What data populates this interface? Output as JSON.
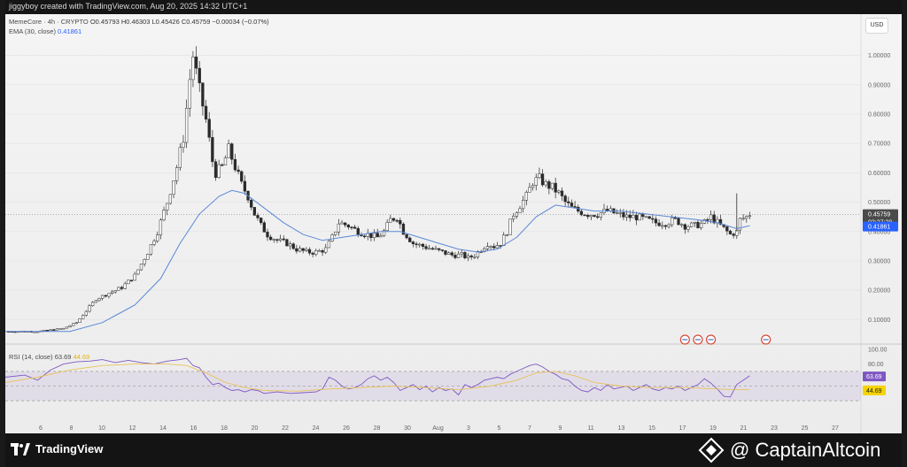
{
  "header": {
    "author_line": "jiggyboy created with TradingView.com, Aug 20, 2025 14:32 UTC+1",
    "symbol": "MemeCore · 4h · CRYPTO",
    "ohlc": "O0.45793  H0.46303  L0.45426  C0.45759  −0.00034 (−0.07%)",
    "ema_label": "EMA (30, close)",
    "ema_value": "0.41861",
    "currency_button": "USD"
  },
  "rsi": {
    "label": "RSI (14, close)",
    "value": "63.69",
    "ma_value": "44.69"
  },
  "footer": {
    "brand_left": "TradingView",
    "brand_right": "@ CaptainAltcoin"
  },
  "colors": {
    "up_candle": "#ffffff",
    "down_candle": "#2a2a2a",
    "ema": "#5b87d6",
    "rsi_line": "#7e57c2",
    "rsi_ma": "#e8c35a",
    "price_tag": "#4a4a4a",
    "ema_tag": "#2962ff",
    "rsi_ma_tag": "#f5d300"
  },
  "chart_data": [
    {
      "type": "candlestick",
      "title": "MemeCore · 4h · CRYPTO",
      "ylim": [
        0.05,
        1.05
      ],
      "yticks": [
        "1.00000",
        "0.90000",
        "0.80000",
        "0.70000",
        "0.60000",
        "0.50000",
        "0.40000",
        "0.30000",
        "0.20000",
        "0.10000"
      ],
      "xticks": [
        "6",
        "8",
        "10",
        "12",
        "14",
        "16",
        "18",
        "20",
        "22",
        "24",
        "26",
        "28",
        "30",
        "Aug",
        "3",
        "5",
        "7",
        "9",
        "11",
        "13",
        "15",
        "17",
        "19",
        "21",
        "23",
        "25",
        "27"
      ],
      "last_price": "0.45759",
      "countdown": "02:27:28",
      "ema_last": "0.41861",
      "price_path": [
        [
          0,
          0.06
        ],
        [
          10,
          0.06
        ],
        [
          18,
          0.07
        ],
        [
          22,
          0.09
        ],
        [
          25,
          0.13
        ],
        [
          28,
          0.17
        ],
        [
          32,
          0.19
        ],
        [
          36,
          0.21
        ],
        [
          40,
          0.25
        ],
        [
          44,
          0.33
        ],
        [
          47,
          0.4
        ],
        [
          50,
          0.5
        ],
        [
          53,
          0.62
        ],
        [
          55,
          0.72
        ],
        [
          57,
          0.92
        ],
        [
          58,
          1.0
        ],
        [
          60,
          0.88
        ],
        [
          62,
          0.78
        ],
        [
          64,
          0.64
        ],
        [
          65,
          0.6
        ],
        [
          67,
          0.62
        ],
        [
          69,
          0.68
        ],
        [
          71,
          0.62
        ],
        [
          73,
          0.56
        ],
        [
          75,
          0.52
        ],
        [
          77,
          0.46
        ],
        [
          79,
          0.42
        ],
        [
          81,
          0.39
        ],
        [
          84,
          0.37
        ],
        [
          87,
          0.36
        ],
        [
          90,
          0.34
        ],
        [
          93,
          0.33
        ],
        [
          96,
          0.33
        ],
        [
          99,
          0.34
        ],
        [
          101,
          0.38
        ],
        [
          103,
          0.43
        ],
        [
          106,
          0.42
        ],
        [
          109,
          0.4
        ],
        [
          112,
          0.39
        ],
        [
          115,
          0.38
        ],
        [
          117,
          0.4
        ],
        [
          119,
          0.44
        ],
        [
          121,
          0.45
        ],
        [
          123,
          0.4
        ],
        [
          126,
          0.36
        ],
        [
          129,
          0.35
        ],
        [
          132,
          0.34
        ],
        [
          135,
          0.33
        ],
        [
          138,
          0.32
        ],
        [
          141,
          0.32
        ],
        [
          143,
          0.31
        ],
        [
          145,
          0.32
        ],
        [
          147,
          0.34
        ],
        [
          149,
          0.36
        ],
        [
          151,
          0.35
        ],
        [
          153,
          0.36
        ],
        [
          155,
          0.4
        ],
        [
          157,
          0.46
        ],
        [
          159,
          0.49
        ],
        [
          161,
          0.52
        ],
        [
          163,
          0.57
        ],
        [
          165,
          0.58
        ],
        [
          167,
          0.56
        ],
        [
          169,
          0.55
        ],
        [
          171,
          0.53
        ],
        [
          173,
          0.5
        ],
        [
          175,
          0.48
        ],
        [
          177,
          0.47
        ],
        [
          180,
          0.46
        ],
        [
          183,
          0.46
        ],
        [
          186,
          0.47
        ],
        [
          189,
          0.46
        ],
        [
          192,
          0.45
        ],
        [
          195,
          0.45
        ],
        [
          198,
          0.44
        ],
        [
          201,
          0.43
        ],
        [
          204,
          0.43
        ],
        [
          207,
          0.44
        ],
        [
          210,
          0.42
        ],
        [
          213,
          0.42
        ],
        [
          216,
          0.43
        ],
        [
          218,
          0.45
        ],
        [
          220,
          0.43
        ],
        [
          222,
          0.41
        ],
        [
          224,
          0.39
        ],
        [
          226,
          0.4
        ],
        [
          227,
          0.44
        ],
        [
          229,
          0.45
        ],
        [
          230,
          0.46
        ]
      ],
      "series": [
        {
          "name": "EMA (30, close)",
          "points": [
            [
              0,
              0.06
            ],
            [
              20,
              0.06
            ],
            [
              30,
              0.09
            ],
            [
              40,
              0.15
            ],
            [
              48,
              0.24
            ],
            [
              54,
              0.36
            ],
            [
              60,
              0.46
            ],
            [
              66,
              0.52
            ],
            [
              70,
              0.54
            ],
            [
              74,
              0.53
            ],
            [
              80,
              0.48
            ],
            [
              86,
              0.43
            ],
            [
              92,
              0.39
            ],
            [
              98,
              0.37
            ],
            [
              104,
              0.38
            ],
            [
              110,
              0.39
            ],
            [
              116,
              0.4
            ],
            [
              122,
              0.4
            ],
            [
              128,
              0.38
            ],
            [
              134,
              0.36
            ],
            [
              140,
              0.34
            ],
            [
              146,
              0.33
            ],
            [
              152,
              0.34
            ],
            [
              158,
              0.38
            ],
            [
              164,
              0.45
            ],
            [
              170,
              0.49
            ],
            [
              176,
              0.48
            ],
            [
              182,
              0.47
            ],
            [
              190,
              0.47
            ],
            [
              198,
              0.46
            ],
            [
              206,
              0.45
            ],
            [
              214,
              0.44
            ],
            [
              220,
              0.43
            ],
            [
              226,
              0.41
            ],
            [
              230,
              0.42
            ]
          ]
        }
      ]
    },
    {
      "type": "line",
      "title": "RSI (14, close)",
      "ylim": [
        0,
        100
      ],
      "yticks": [
        "100.00",
        "80.00"
      ],
      "bands": [
        70,
        50,
        30
      ],
      "series": [
        {
          "name": "RSI (14, close)",
          "points": [
            [
              0,
              62
            ],
            [
              6,
              65
            ],
            [
              10,
              58
            ],
            [
              14,
              72
            ],
            [
              18,
              80
            ],
            [
              22,
              83
            ],
            [
              26,
              84
            ],
            [
              30,
              86
            ],
            [
              34,
              82
            ],
            [
              38,
              85
            ],
            [
              42,
              82
            ],
            [
              46,
              80
            ],
            [
              50,
              84
            ],
            [
              54,
              86
            ],
            [
              56,
              88
            ],
            [
              58,
              78
            ],
            [
              60,
              75
            ],
            [
              62,
              62
            ],
            [
              64,
              52
            ],
            [
              66,
              54
            ],
            [
              68,
              48
            ],
            [
              70,
              44
            ],
            [
              72,
              45
            ],
            [
              74,
              42
            ],
            [
              76,
              45
            ],
            [
              78,
              44
            ],
            [
              80,
              40
            ],
            [
              84,
              42
            ],
            [
              88,
              40
            ],
            [
              92,
              41
            ],
            [
              96,
              42
            ],
            [
              98,
              46
            ],
            [
              100,
              62
            ],
            [
              102,
              58
            ],
            [
              104,
              50
            ],
            [
              106,
              46
            ],
            [
              108,
              48
            ],
            [
              110,
              52
            ],
            [
              112,
              60
            ],
            [
              114,
              64
            ],
            [
              116,
              58
            ],
            [
              118,
              62
            ],
            [
              120,
              55
            ],
            [
              122,
              44
            ],
            [
              124,
              48
            ],
            [
              126,
              52
            ],
            [
              128,
              45
            ],
            [
              130,
              50
            ],
            [
              132,
              42
            ],
            [
              134,
              48
            ],
            [
              136,
              44
            ],
            [
              138,
              46
            ],
            [
              140,
              38
            ],
            [
              142,
              52
            ],
            [
              144,
              48
            ],
            [
              146,
              52
            ],
            [
              148,
              58
            ],
            [
              150,
              60
            ],
            [
              152,
              62
            ],
            [
              154,
              60
            ],
            [
              156,
              66
            ],
            [
              158,
              70
            ],
            [
              160,
              74
            ],
            [
              162,
              78
            ],
            [
              164,
              80
            ],
            [
              166,
              76
            ],
            [
              168,
              70
            ],
            [
              170,
              66
            ],
            [
              172,
              60
            ],
            [
              174,
              58
            ],
            [
              176,
              50
            ],
            [
              178,
              44
            ],
            [
              180,
              42
            ],
            [
              182,
              48
            ],
            [
              184,
              44
            ],
            [
              186,
              52
            ],
            [
              188,
              46
            ],
            [
              190,
              48
            ],
            [
              192,
              50
            ],
            [
              194,
              44
            ],
            [
              196,
              48
            ],
            [
              198,
              52
            ],
            [
              200,
              46
            ],
            [
              202,
              44
            ],
            [
              204,
              48
            ],
            [
              206,
              46
            ],
            [
              208,
              50
            ],
            [
              210,
              44
            ],
            [
              212,
              48
            ],
            [
              214,
              52
            ],
            [
              216,
              60
            ],
            [
              218,
              54
            ],
            [
              220,
              46
            ],
            [
              222,
              36
            ],
            [
              224,
              35
            ],
            [
              226,
              52
            ],
            [
              228,
              58
            ],
            [
              230,
              64
            ]
          ]
        },
        {
          "name": "44.69",
          "points": [
            [
              0,
              55
            ],
            [
              10,
              62
            ],
            [
              20,
              72
            ],
            [
              30,
              78
            ],
            [
              40,
              80
            ],
            [
              50,
              80
            ],
            [
              56,
              78
            ],
            [
              62,
              68
            ],
            [
              68,
              55
            ],
            [
              74,
              48
            ],
            [
              80,
              44
            ],
            [
              90,
              43
            ],
            [
              100,
              46
            ],
            [
              110,
              48
            ],
            [
              120,
              50
            ],
            [
              130,
              48
            ],
            [
              140,
              45
            ],
            [
              150,
              50
            ],
            [
              158,
              58
            ],
            [
              164,
              68
            ],
            [
              170,
              70
            ],
            [
              176,
              64
            ],
            [
              182,
              55
            ],
            [
              190,
              50
            ],
            [
              200,
              48
            ],
            [
              210,
              48
            ],
            [
              220,
              46
            ],
            [
              226,
              45
            ],
            [
              230,
              45
            ]
          ]
        }
      ]
    }
  ]
}
